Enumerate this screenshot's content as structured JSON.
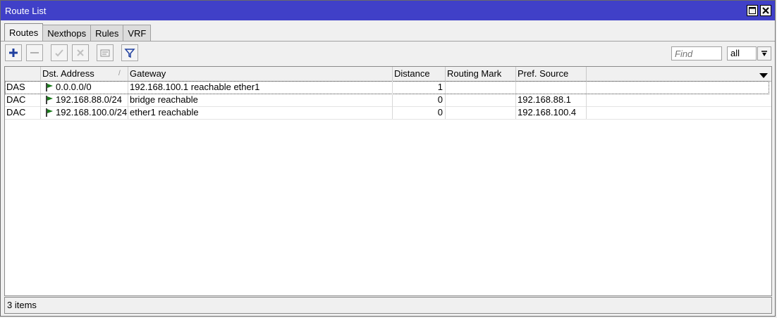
{
  "window": {
    "title": "Route List"
  },
  "tabs": [
    {
      "label": "Routes"
    },
    {
      "label": "Nexthops"
    },
    {
      "label": "Rules"
    },
    {
      "label": "VRF"
    }
  ],
  "toolbar": {
    "find_placeholder": "Find",
    "filter_value": "all"
  },
  "table": {
    "columns": [
      "",
      "Dst. Address",
      "Gateway",
      "Distance",
      "Routing Mark",
      "Pref. Source"
    ],
    "rows": [
      {
        "flags": "DAS",
        "dst": "0.0.0.0/0",
        "gateway": "192.168.100.1 reachable ether1",
        "distance": "1",
        "mark": "",
        "pref": ""
      },
      {
        "flags": "DAC",
        "dst": "192.168.88.0/24",
        "gateway": "bridge reachable",
        "distance": "0",
        "mark": "",
        "pref": "192.168.88.1"
      },
      {
        "flags": "DAC",
        "dst": "192.168.100.0/24",
        "gateway": "ether1 reachable",
        "distance": "0",
        "mark": "",
        "pref": "192.168.100.4"
      }
    ]
  },
  "status": {
    "text": "3 items"
  },
  "colors": {
    "titlebar": "#4040c8",
    "accent": "#1f3f9f",
    "flag": "#1a7a1a"
  }
}
